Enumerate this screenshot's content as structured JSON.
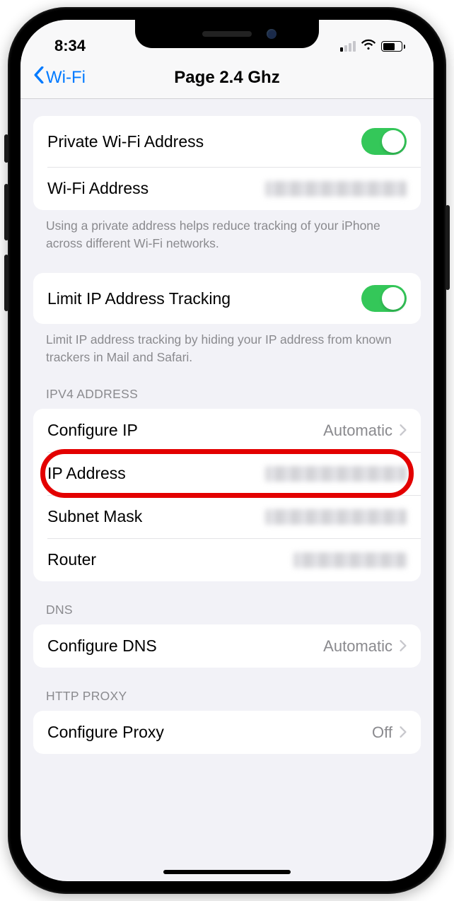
{
  "status": {
    "time": "8:34"
  },
  "nav": {
    "back": "Wi-Fi",
    "title": "Page 2.4 Ghz"
  },
  "group1": {
    "private_wifi": "Private Wi-Fi Address",
    "wifi_address": "Wi-Fi Address",
    "footer": "Using a private address helps reduce tracking of your iPhone across different Wi-Fi networks."
  },
  "group2": {
    "limit_tracking": "Limit IP Address Tracking",
    "footer": "Limit IP address tracking by hiding your IP address from known trackers in Mail and Safari."
  },
  "ipv4": {
    "header": "IPV4 ADDRESS",
    "configure_ip": "Configure IP",
    "configure_ip_val": "Automatic",
    "ip_address": "IP Address",
    "subnet": "Subnet Mask",
    "router": "Router"
  },
  "dns": {
    "header": "DNS",
    "configure": "Configure DNS",
    "value": "Automatic"
  },
  "proxy": {
    "header": "HTTP PROXY",
    "configure": "Configure Proxy",
    "value": "Off"
  }
}
